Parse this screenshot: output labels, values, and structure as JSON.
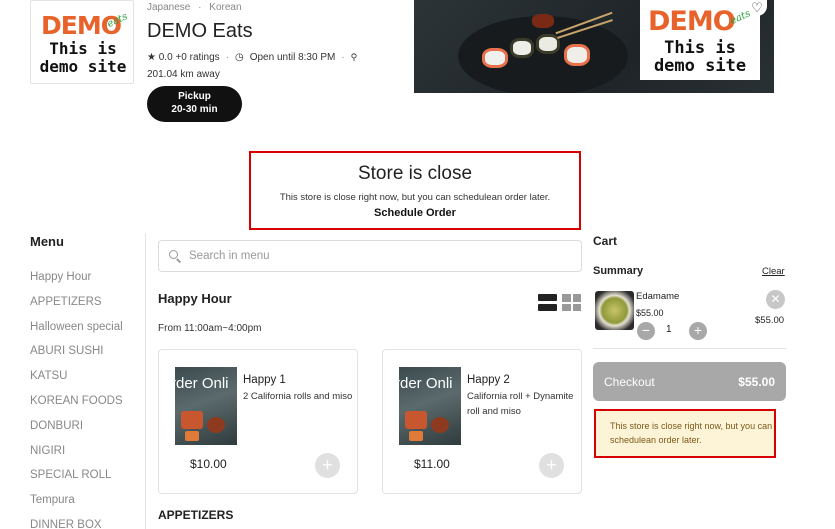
{
  "store": {
    "logo_text_main": "DEMO",
    "logo_text_sub": "eats",
    "logo_line1": "This is",
    "logo_line2": "demo site",
    "cuisine_1": "Japanese",
    "cuisine_2": "Korean",
    "name": "DEMO Eats",
    "rating": "★ 0.0",
    "ratings_count": "+0 ratings",
    "hours": "Open until 8:30 PM",
    "distance": "201.04 km away",
    "pickup_label": "Pickup",
    "pickup_time": "20-30 min"
  },
  "closed_banner": {
    "title": "Store is close",
    "text": "This store is close right now, but you can schedulean order later.",
    "schedule_label": "Schedule Order"
  },
  "menu": {
    "title": "Menu",
    "items": [
      "Happy Hour",
      "APPETIZERS",
      "Halloween special",
      "ABURI SUSHI",
      "KATSU",
      "KOREAN FOODS",
      "DONBURI",
      "NIGIRI",
      "SPECIAL ROLL",
      "Tempura",
      "DINNER BOX"
    ]
  },
  "search": {
    "placeholder": "Search in menu"
  },
  "section": {
    "title": "Happy Hour",
    "hours": "From 11:00am~4:00pm",
    "next_title": "APPETIZERS"
  },
  "products": [
    {
      "image_text": "rder Onli",
      "name": "Happy 1",
      "description": "2 California rolls and miso",
      "price": "$10.00"
    },
    {
      "image_text": "rder Onli",
      "name": "Happy 2",
      "description": "California roll + Dynamite roll and miso",
      "price": "$11.00"
    }
  ],
  "cart": {
    "title": "Cart",
    "summary_label": "Summary",
    "clear_label": "Clear",
    "item": {
      "name": "Edamame",
      "unit_price": "$55.00",
      "quantity": "1",
      "total": "$55.00"
    },
    "checkout_label": "Checkout",
    "checkout_amount": "$55.00",
    "closed_notice": "This store is close right now, but you can schedulean order later."
  },
  "colors": {
    "brand_orange": "#e8632b",
    "alert_red": "#d60000",
    "notice_bg": "#fdf3d6"
  },
  "icons": {
    "star": "star-icon",
    "clock": "clock-icon",
    "pin": "location-pin-icon",
    "heart": "heart-icon",
    "search": "search-icon",
    "list_view": "list-view-icon",
    "grid_view": "grid-view-icon",
    "add": "plus-icon",
    "remove": "close-icon"
  }
}
